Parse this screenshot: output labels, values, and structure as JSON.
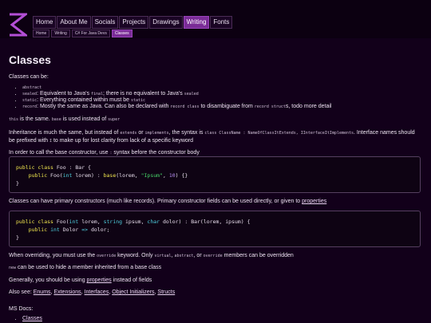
{
  "nav": {
    "items": [
      "Home",
      "About Me",
      "Socials",
      "Projects",
      "Drawings",
      "Writing",
      "Fonts"
    ],
    "active_index": 5
  },
  "breadcrumb": [
    "Home",
    "Writing",
    "C# For Java Devs",
    "Classes"
  ],
  "page": {
    "title": "Classes",
    "intro": "Classes can be:",
    "list": [
      {
        "code": "abstract"
      },
      {
        "code": "sealed",
        "text_a": ": Equivalent to Java's ",
        "code2": "final",
        "text_b": "; there is no equivalent to Java's ",
        "code3": "sealed"
      },
      {
        "code": "static",
        "text_a": ": Everything contained within must be ",
        "code2": "static"
      },
      {
        "code": "record",
        "text_a": ": Mostly the same as Java. Can also be declared with ",
        "code2": "record class",
        "text_b": " to disambiguate from ",
        "code3": "record struct",
        "text_c": "s, todo more detail"
      }
    ],
    "p_this_code": "this",
    "p_this_text": " is the same. ",
    "p_base_code": "base",
    "p_base_text": " is used instead of ",
    "p_super_code": "super",
    "inherit_a": "Inheritance is much the same, but instead of ",
    "inherit_extends": "extends",
    "inherit_b": " or ",
    "inherit_implements": "implements",
    "inherit_c": ", the syntax is ",
    "inherit_code": "class ClassName : NameOfClassItExtends, IInterfaceItImplements",
    "inherit_d": ". Interface names should be prefixed with ",
    "inherit_i": "I",
    "inherit_e": " to make up for lost clarity from lack of a specific keyword",
    "base_ctor_a": "In order to call the base constructor, use ",
    "base_ctor_colon": ":",
    "base_ctor_b": " syntax before the constructor body",
    "code1": [
      "public class Foo : Bar {",
      "    public Foo(int lorem) : base(lorem, \"Ipsum\", 10) {}",
      "}"
    ],
    "primary_a": "Classes can have primary constructors (much like records). Primary constructor fields can be used directly, or given to ",
    "primary_link": "properties",
    "code2": [
      "public class Foo(int lorem, string ipsum, char dolor) : Bar(lorem, ipsum) {",
      "    public int Dolor => dolor;",
      "}"
    ],
    "override_a": "When overriding, you must use the ",
    "override_code": "override",
    "override_b": " keyword. Only ",
    "override_virtual": "virtual",
    "override_c": ", ",
    "override_abstract": "abstract",
    "override_d": ", or ",
    "override_override": "override",
    "override_e": " members can be overridden",
    "new_code": "new",
    "new_text": " can be used to hide a member inherited from a base class",
    "props_a": "Generally, you should be using ",
    "props_link": "properties",
    "props_b": " instead of fields",
    "also_label": "Also see: ",
    "also_links": [
      "Enums",
      "Extensions",
      "Interfaces",
      "Object Initializers",
      "Structs"
    ],
    "msdocs_label": "MS Docs:",
    "msdocs_links": [
      "Classes"
    ]
  },
  "colors": {
    "background": "#12001a",
    "accent": "#7a2c97"
  },
  "icons": {
    "logo": "hourglass-logo-icon"
  }
}
